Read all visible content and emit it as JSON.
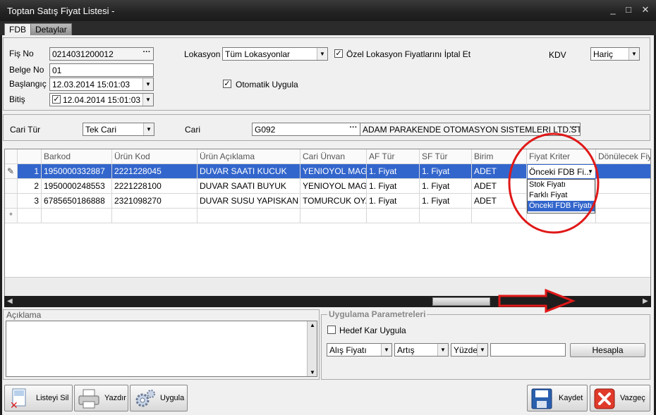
{
  "window": {
    "title": "Toptan Satış Fiyat Listesi -",
    "minimize": "_",
    "restore": "□",
    "close": "✕"
  },
  "tabs": [
    {
      "label": "FDB"
    },
    {
      "label": "Detaylar"
    }
  ],
  "header": {
    "fis_no_label": "Fiş No",
    "fis_no_value": "0214031200012",
    "belge_no_label": "Belge No",
    "belge_no_value": "01",
    "baslangic_label": "Başlangıç",
    "baslangic_value": "12.03.2014 15:01:03",
    "bitis_label": "Bitiş",
    "bitis_value": "12.04.2014 15:01:03",
    "lokasyon_label": "Lokasyon",
    "lokasyon_value": "Tüm Lokasyonlar",
    "ozel_lokasyon_label": "Özel Lokasyon Fiyatlarını İptal Et",
    "otomatik_uygula_label": "Otomatik Uygula",
    "kdv_label": "KDV",
    "kdv_value": "Hariç"
  },
  "cari": {
    "cari_tur_label": "Cari Tür",
    "cari_tur_value": "Tek Cari",
    "cari_label": "Cari",
    "cari_code": "G092",
    "cari_name": "ADAM PARAKENDE OTOMASYON SISTEMLERI LTD.STI"
  },
  "grid": {
    "columns": [
      "Barkod",
      "Ürün Kod",
      "Ürün Açıklama",
      "Cari Ünvan",
      "AF Tür",
      "SF Tür",
      "Birim",
      "Fiyat Kriter",
      "Dönülecek Fiyat"
    ],
    "rows": [
      {
        "no": "1",
        "barkod": "1950000332887",
        "urun_kod": "2221228045",
        "aciklama": "DUVAR SAATI  KUCUK",
        "cari": "YENIOYOL MAG...",
        "af": "1. Fiyat",
        "sf": "1. Fiyat",
        "birim": "ADET",
        "kriter": "Önceki FDB Fi..."
      },
      {
        "no": "2",
        "barkod": "1950000248553",
        "urun_kod": "2221228100",
        "aciklama": "DUVAR SAATI BUYUK",
        "cari": "YENIOYOL MAG...",
        "af": "1. Fiyat",
        "sf": "1. Fiyat",
        "birim": "ADET",
        "kriter": ""
      },
      {
        "no": "3",
        "barkod": "6785650186888",
        "urun_kod": "2321098270",
        "aciklama": "DUVAR SUSU YAPISKAN",
        "cari": "TOMURCUK OY...",
        "af": "1. Fiyat",
        "sf": "1. Fiyat",
        "birim": "ADET",
        "kriter": ""
      }
    ],
    "new_row_marker": "*",
    "edit_marker": "✎",
    "dropdown_options": [
      "Stok Fiyatı",
      "Farklı Fiyat",
      "Önceki FDB Fiyatı"
    ],
    "dropdown_selected": "Önceki FDB Fiyatı"
  },
  "aciklama": {
    "label": "Açıklama",
    "value": ""
  },
  "params": {
    "title": "Uygulama Parametreleri",
    "hedef_kar_label": "Hedef Kar Uygula",
    "alis_value": "Alış Fiyatı",
    "artis_value": "Artış",
    "yuzde_value": "Yüzde",
    "amount_value": "",
    "hesapla_label": "Hesapla"
  },
  "footer": {
    "listeyi_sil": "Listeyi Sil",
    "yazdir": "Yazdır",
    "uygula": "Uygula",
    "kaydet": "Kaydet",
    "vazgec": "Vazgeç"
  },
  "colors": {
    "selection": "#3366cc",
    "annotation": "#e01818",
    "title_bg": "#222222"
  },
  "icons": [
    "document-delete-icon",
    "printer-icon",
    "gears-icon",
    "floppy-disk-icon",
    "cancel-x-icon"
  ]
}
